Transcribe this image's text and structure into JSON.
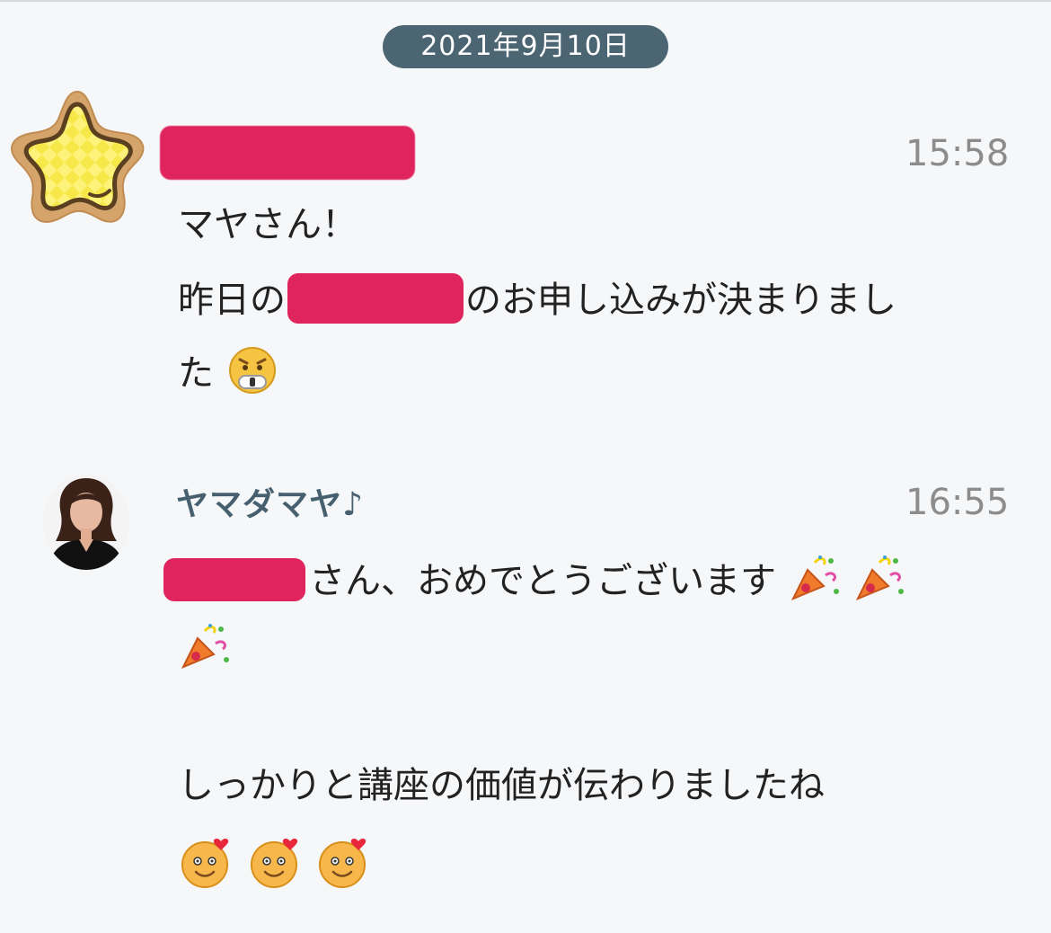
{
  "chat": {
    "date_separator": "2021年9月10日",
    "messages": [
      {
        "sender_name_redacted": true,
        "time": "15:58",
        "lines": [
          "マヤさん！",
          "昨日の",
          "のお申し込みが決まりまし",
          "た"
        ],
        "emojis": [
          "scared-face"
        ]
      },
      {
        "sender_name": "ヤマダマヤ♪",
        "time": "16:55",
        "lines": [
          "さん、おめでとうございます",
          "しっかりと講座の価値が伝わりましたね"
        ],
        "emojis": [
          "party-popper",
          "party-popper",
          "party-popper",
          "smiling-face-with-heart",
          "smiling-face-with-heart",
          "smiling-face-with-heart"
        ]
      }
    ]
  },
  "colors": {
    "background": "#f6f7f9",
    "date_pill": "#4b6572",
    "name": "#476070",
    "redaction": "#e0245e",
    "time": "#8c8c8c"
  }
}
